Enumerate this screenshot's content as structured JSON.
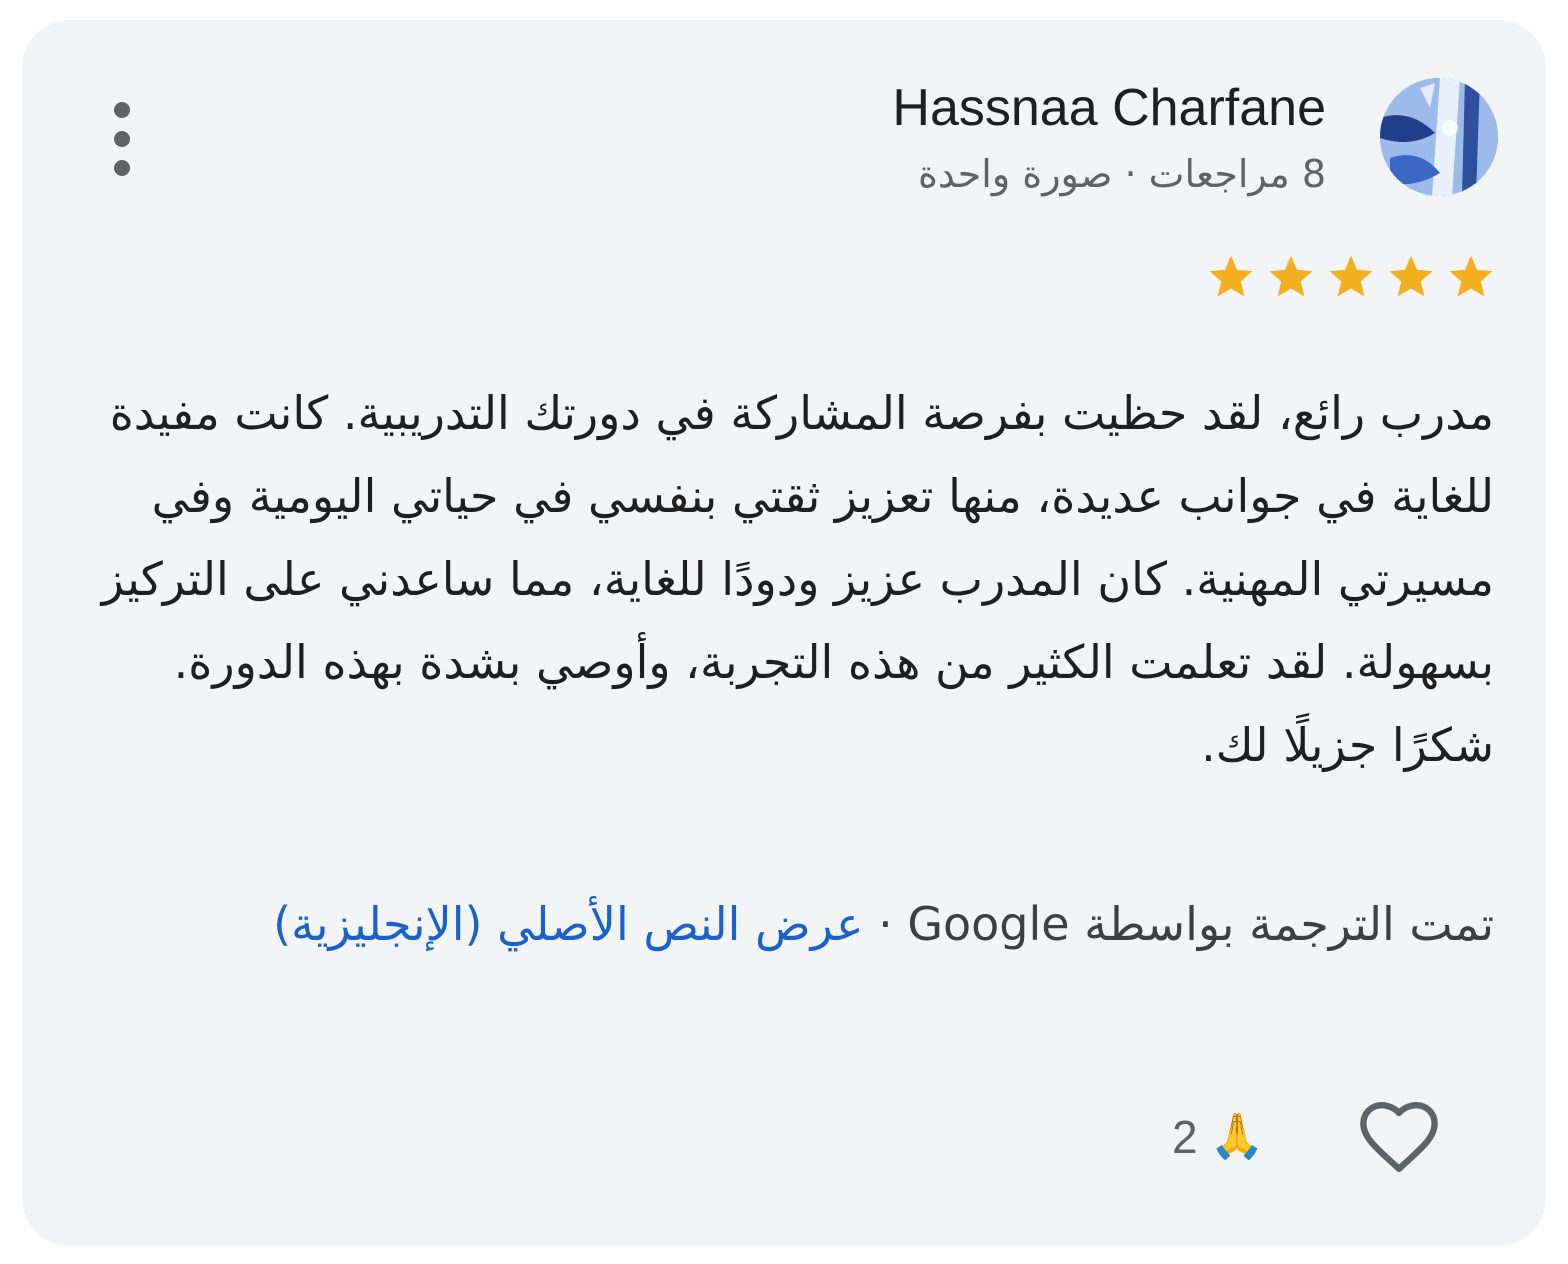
{
  "reviewer": {
    "name": "Hassnaa Charfane",
    "meta": "8 مراجعات · صورة واحدة"
  },
  "rating": {
    "value": 5,
    "max": 5,
    "color": "#f2b01e"
  },
  "review": {
    "text": "مدرب رائع، لقد حظيت بفرصة المشاركة في دورتك التدريبية. كانت مفيدة للغاية في جوانب عديدة، منها تعزيز ثقتي بنفسي في حياتي اليومية وفي مسيرتي المهنية. كان المدرب عزيز ودودًا للغاية، مما ساعدني على التركيز بسهولة. لقد تعلمت الكثير من هذه التجربة، وأوصي بشدة بهذه الدورة. شكرًا جزيلًا لك."
  },
  "translation": {
    "note": "تمت الترجمة بواسطة Google",
    "separator": "·",
    "link": "عرض النص الأصلي (الإنجليزية)",
    "link_color": "#1a62c9"
  },
  "reactions": {
    "emoji": "🙏",
    "count": "2"
  },
  "icons": {
    "menu": "more-vert-icon",
    "like": "heart-outline-icon",
    "star": "star-icon"
  }
}
